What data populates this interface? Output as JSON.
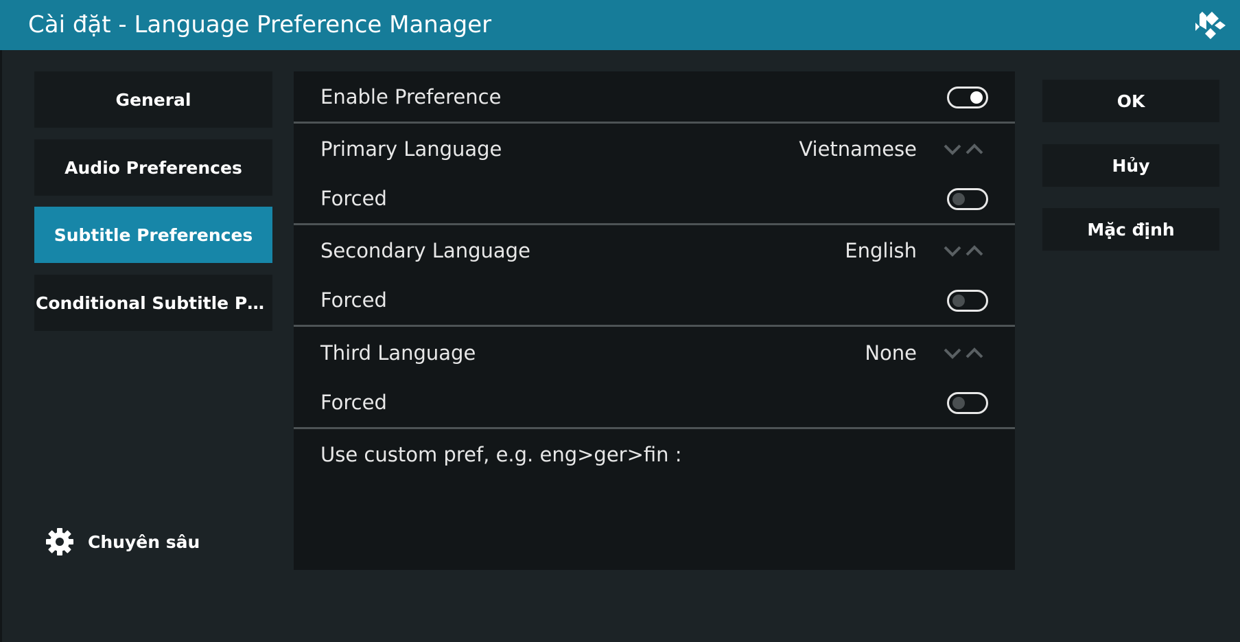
{
  "window": {
    "title": "Cài đặt - Language Preference Manager",
    "logo_icon": "kodi-logo-icon"
  },
  "sidebar": {
    "items": [
      {
        "label": "General",
        "active": false
      },
      {
        "label": "Audio Preferences",
        "active": false
      },
      {
        "label": "Subtitle Preferences",
        "active": true
      },
      {
        "label": "Conditional Subtitle Prefe…",
        "active": false
      }
    ],
    "advanced": {
      "label": "Chuyên sâu",
      "icon": "gear-icon"
    }
  },
  "settings": {
    "enable_preference": {
      "label": "Enable Preference",
      "enabled": true
    },
    "primary_language": {
      "label": "Primary Language",
      "value": "Vietnamese"
    },
    "primary_forced": {
      "label": "Forced",
      "enabled": false
    },
    "secondary_language": {
      "label": "Secondary Language",
      "value": "English"
    },
    "secondary_forced": {
      "label": "Forced",
      "enabled": false
    },
    "third_language": {
      "label": "Third Language",
      "value": "None"
    },
    "third_forced": {
      "label": "Forced",
      "enabled": false
    },
    "custom_pref": {
      "label": "Use custom pref, e.g. eng>ger>fin :"
    }
  },
  "actions": {
    "ok": "OK",
    "cancel": "Hủy",
    "default": "Mặc định"
  },
  "colors": {
    "accent": "#167c99",
    "active_item": "#1786a8",
    "background": "#1c2326",
    "panel": "#121618"
  }
}
